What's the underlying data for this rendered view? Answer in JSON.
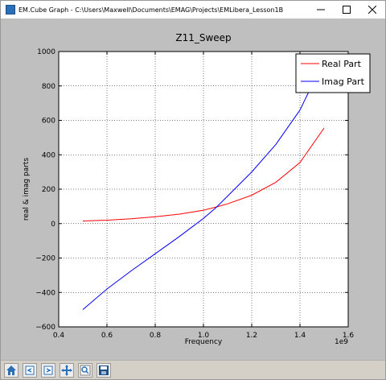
{
  "window": {
    "title": "EM.Cube Graph - C:\\Users\\Maxwell\\Documents\\EMAG\\Projects\\EMLibera_Lesson1B",
    "minimize_icon": "minimize-icon",
    "maximize_icon": "maximize-icon",
    "close_icon": "close-icon"
  },
  "toolbar": {
    "buttons": [
      {
        "icon": "home-icon"
      },
      {
        "icon": "back-icon"
      },
      {
        "icon": "forward-icon"
      },
      {
        "icon": "pan-icon"
      },
      {
        "icon": "zoom-icon"
      },
      {
        "icon": "save-icon"
      }
    ]
  },
  "chart_data": {
    "type": "line",
    "title": "Z11_Sweep",
    "xlabel": "Frequency",
    "ylabel": "real & imag parts",
    "x_offset_label": "1e9",
    "xlim": [
      0.4,
      1.6
    ],
    "ylim": [
      -600,
      1000
    ],
    "x_ticks": [
      "0.4",
      "0.6",
      "0.8",
      "1.0",
      "1.2",
      "1.4",
      "1.6"
    ],
    "y_ticks": [
      "−600",
      "−400",
      "−200",
      "0",
      "200",
      "400",
      "600",
      "800",
      "1000"
    ],
    "grid": true,
    "legend_position": "top-right",
    "series": [
      {
        "name": "Real Part",
        "color": "#ff0000",
        "x": [
          0.5,
          0.6,
          0.7,
          0.8,
          0.9,
          1.0,
          1.05,
          1.1,
          1.2,
          1.3,
          1.4,
          1.5
        ],
        "values": [
          15,
          20,
          28,
          40,
          55,
          78,
          95,
          115,
          165,
          240,
          355,
          555
        ]
      },
      {
        "name": "Imag Part",
        "color": "#0000ff",
        "x": [
          0.5,
          0.6,
          0.7,
          0.8,
          0.9,
          1.0,
          1.05,
          1.1,
          1.2,
          1.3,
          1.4,
          1.5
        ],
        "values": [
          -500,
          -380,
          -275,
          -175,
          -75,
          30,
          90,
          160,
          300,
          460,
          660,
          950
        ]
      }
    ]
  }
}
